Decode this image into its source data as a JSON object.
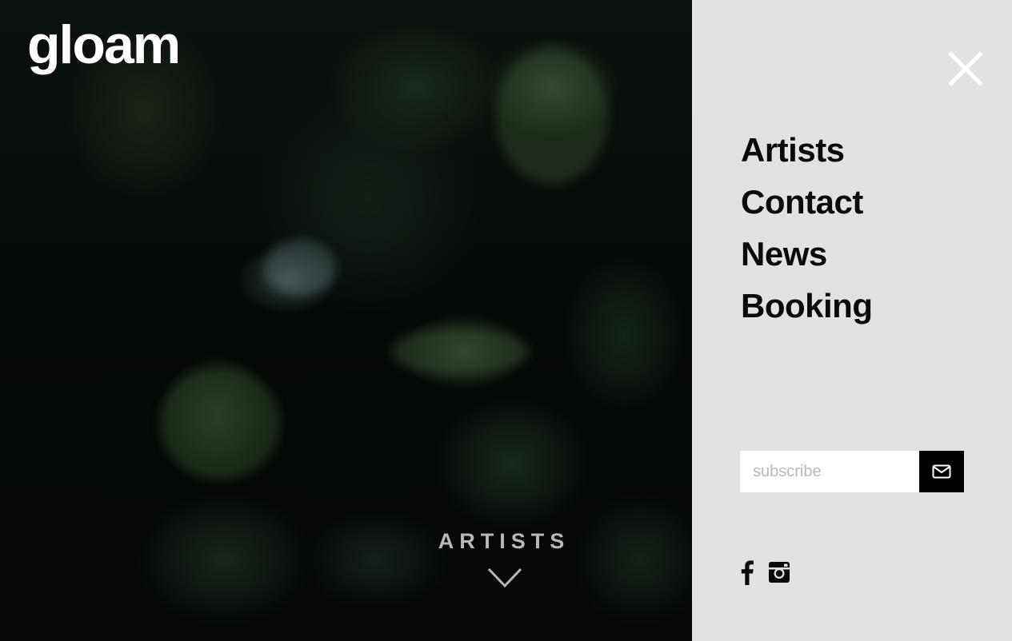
{
  "brand": {
    "logo_text": "gloam"
  },
  "hero": {
    "section_label": "ARTISTS"
  },
  "menu": {
    "items": [
      {
        "label": "Artists"
      },
      {
        "label": "Contact"
      },
      {
        "label": "News"
      },
      {
        "label": "Booking"
      }
    ]
  },
  "subscribe": {
    "placeholder": "subscribe",
    "value": ""
  },
  "icons": {
    "close": "close-icon",
    "scroll_down": "chevron-down-icon",
    "submit": "envelope-icon",
    "facebook": "facebook-icon",
    "instagram": "instagram-icon"
  },
  "colors": {
    "panel_bg": "#e2e2e2",
    "menu_text": "#0a0a0a",
    "hero_label": "#b7b9b6",
    "submit_bg": "#000000"
  }
}
